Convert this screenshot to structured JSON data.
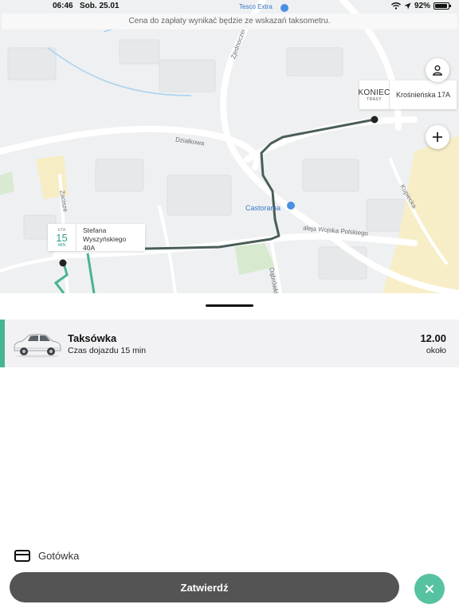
{
  "status": {
    "time": "06:46",
    "date": "Sob. 25.01",
    "battery": "92%",
    "battery_level": 0.92
  },
  "banner": {
    "text": "Cena do zapłaty wynikać będzie ze wskazań taksometru."
  },
  "map": {
    "streets": [
      "Tesco Extra",
      "Zjednoczenia",
      "Działkowa",
      "Castorama",
      "aleja Wojska Polskiego",
      "Zacisze",
      "Kupiecka",
      "Dąbrówki"
    ],
    "end_point": {
      "tag": "KONIEC",
      "tag_sub": "TRASY",
      "address": "Krośnieńska 17A"
    },
    "start_point": {
      "eta_label": "ETA",
      "eta_value": "15",
      "eta_unit": "MIN",
      "address_line1": "Stefana",
      "address_line2": "Wyszyńskiego",
      "address_line3": "40A"
    },
    "route_color": "#4a5e58",
    "walk_color": "#47b591"
  },
  "ride": {
    "name": "Taksówka",
    "eta_text": "Czas dojazdu 15 min",
    "price": "12.00",
    "price_note": "około",
    "accent_color": "#47b591"
  },
  "payment": {
    "label": "Gotówka"
  },
  "actions": {
    "confirm_label": "Zatwierdź"
  },
  "icons": {
    "profile": "person-icon",
    "zoom": "plus-icon",
    "close": "close-icon",
    "payment": "credit-card-icon",
    "car": "car-icon"
  }
}
